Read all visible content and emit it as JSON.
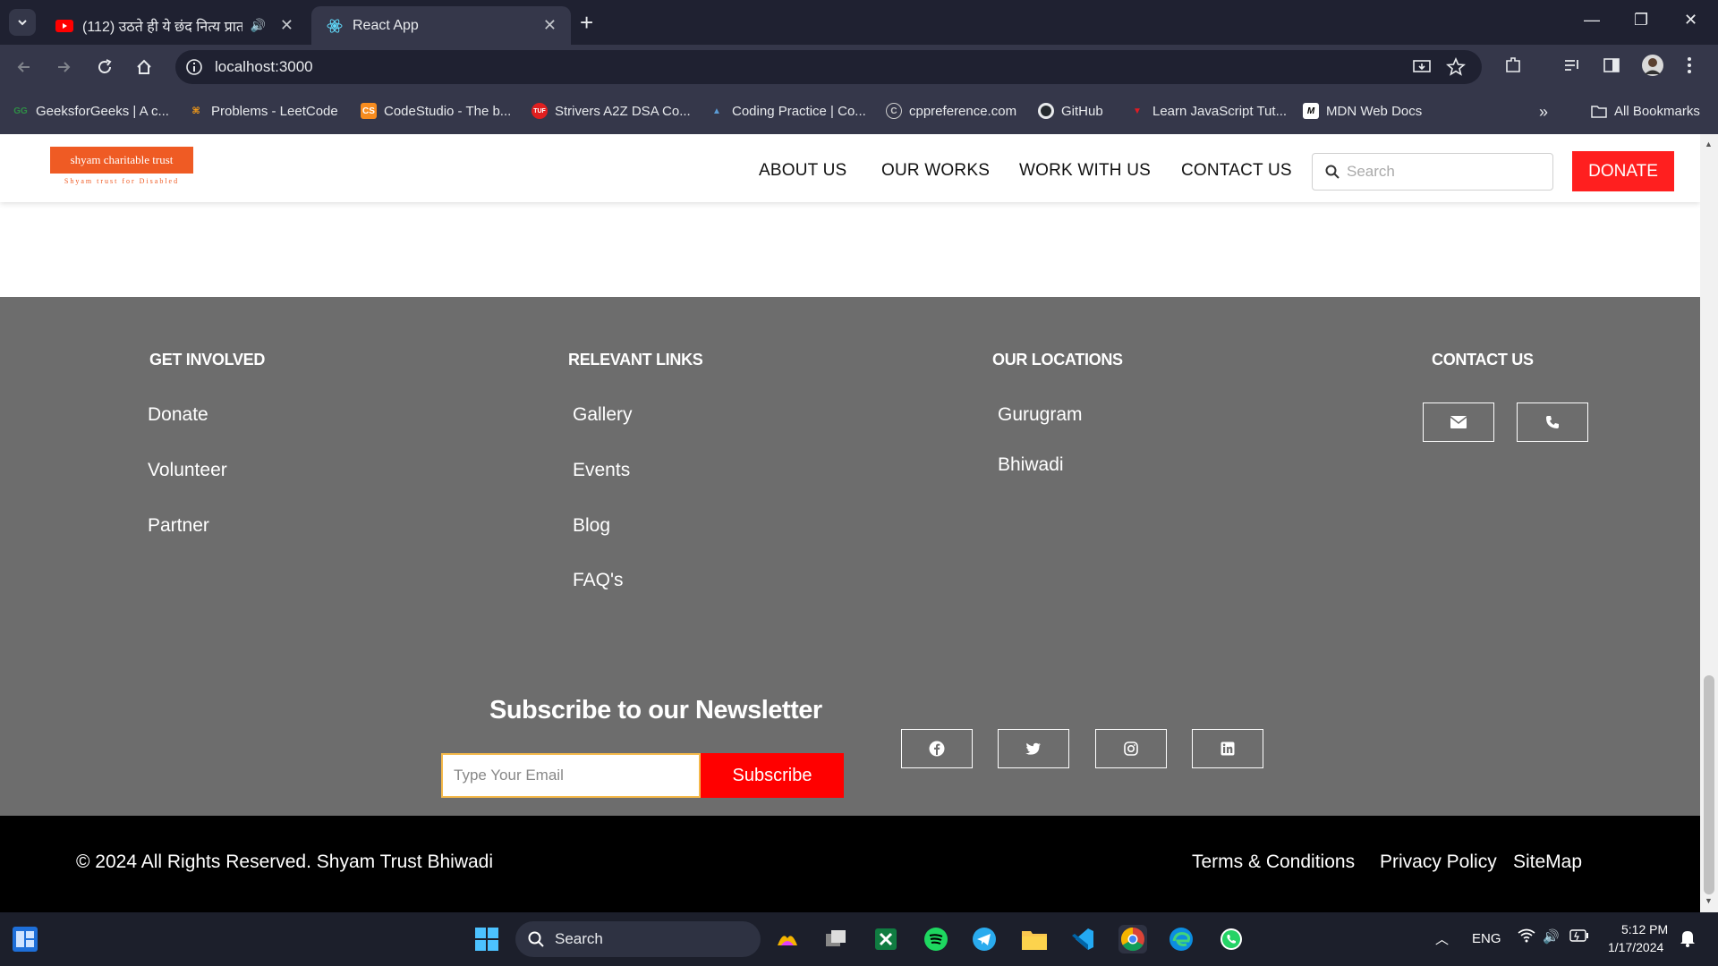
{
  "browser": {
    "tabs": [
      {
        "title": "(112) उठते ही ये छंद नित्य प्रात",
        "active": false
      },
      {
        "title": "React App",
        "active": true
      }
    ],
    "url": "localhost:3000",
    "bookmarks": [
      {
        "label": "GeeksforGeeks | A c...",
        "icon": "gfg-icon"
      },
      {
        "label": "Problems - LeetCode",
        "icon": "leetcode-icon"
      },
      {
        "label": "CodeStudio - The b...",
        "icon": "codestudio-icon"
      },
      {
        "label": "Strivers A2Z DSA Co...",
        "icon": "tuf-icon"
      },
      {
        "label": "Coding Practice | Co...",
        "icon": "codechef-icon"
      },
      {
        "label": "cppreference.com",
        "icon": "cppreference-icon"
      },
      {
        "label": "GitHub",
        "icon": "github-icon"
      },
      {
        "label": "Learn JavaScript Tut...",
        "icon": "js-icon"
      },
      {
        "label": "MDN Web Docs",
        "icon": "mdn-icon"
      }
    ],
    "all_bookmarks": "All Bookmarks"
  },
  "header": {
    "logo_text": "shyam charitable trust",
    "logo_tagline": "Shyam trust for Disabled",
    "nav": [
      "ABOUT US",
      "OUR WORKS",
      "WORK WITH US",
      "CONTACT US"
    ],
    "search_placeholder": "Search",
    "donate_label": "DONATE"
  },
  "footer": {
    "get_involved": {
      "title": "GET INVOLVED",
      "links": [
        "Donate",
        "Volunteer",
        "Partner"
      ]
    },
    "relevant_links": {
      "title": "RELEVANT LINKS",
      "links": [
        "Gallery",
        "Events",
        "Blog",
        "FAQ's"
      ]
    },
    "locations": {
      "title": "OUR LOCATIONS",
      "links": [
        "Gurugram",
        "Bhiwadi"
      ]
    },
    "contact": {
      "title": "CONTACT US",
      "buttons": [
        "envelope-icon",
        "phone-icon"
      ]
    },
    "newsletter": {
      "title": "Subscribe to our Newsletter",
      "placeholder": "Type Your Email",
      "button": "Subscribe"
    },
    "social": [
      "facebook-icon",
      "twitter-icon",
      "instagram-icon",
      "linkedin-icon"
    ],
    "copyright": "© 2024 All Rights Reserved. Shyam Trust Bhiwadi",
    "bottom_links": [
      "Terms & Conditions",
      "Privacy Policy",
      "SiteMap"
    ]
  },
  "taskbar": {
    "search_label": "Search",
    "lang": "ENG",
    "time": "5:12 PM",
    "date": "1/17/2024"
  },
  "colors": {
    "accent_red": "#ff1f1f",
    "footer_bg": "#6d6d6d",
    "logo_orange": "#ef5b24"
  }
}
